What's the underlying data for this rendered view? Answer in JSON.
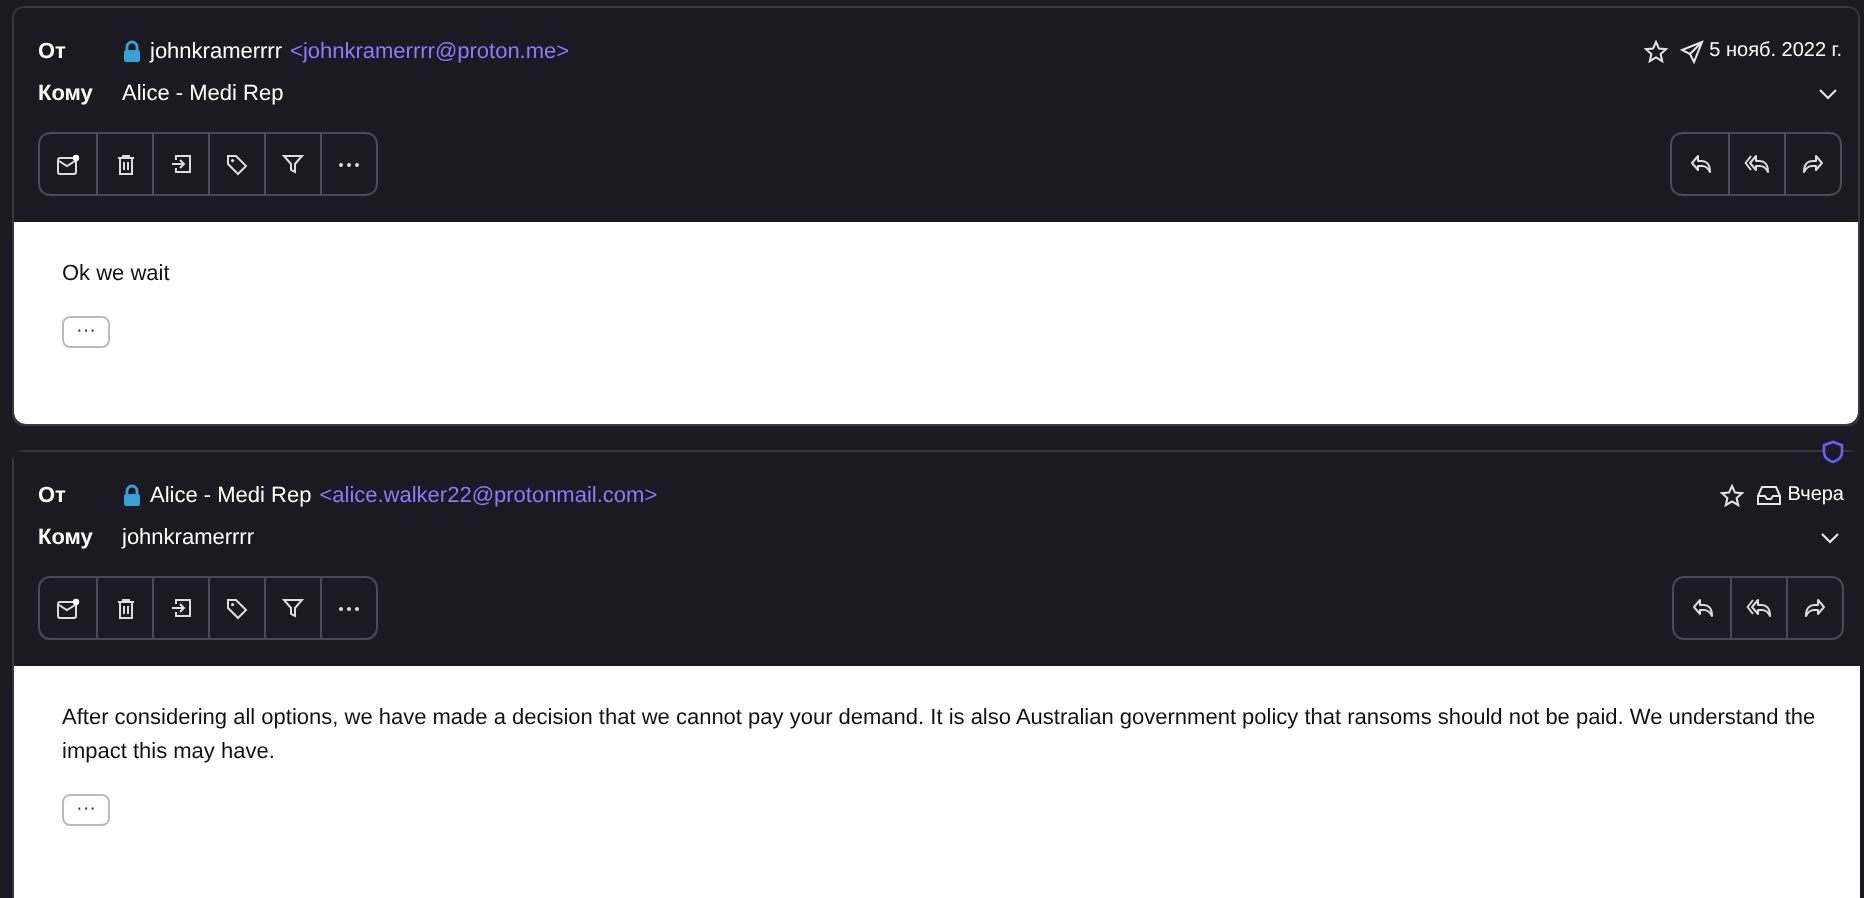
{
  "messages": [
    {
      "kind": "sent",
      "from_label": "От",
      "from_name": "johnkramerrrr",
      "from_address": "<johnkramerrrr@proton.me>",
      "to_label": "Кому",
      "to": "Alice - Medi Rep",
      "date": "5 нояб. 2022 г.",
      "body": "Ok we wait",
      "more": "···",
      "shield": false
    },
    {
      "kind": "received",
      "from_label": "От",
      "from_name": "Alice - Medi Rep",
      "from_address": "<alice.walker22@protonmail.com>",
      "to_label": "Кому",
      "to": "johnkramerrrr",
      "date": "Вчера",
      "body": "After considering all options, we have made a decision that we cannot pay your demand. It is also Australian government policy that ransoms should not be paid. We understand the impact this may have.",
      "more": "···",
      "shield": true
    }
  ]
}
